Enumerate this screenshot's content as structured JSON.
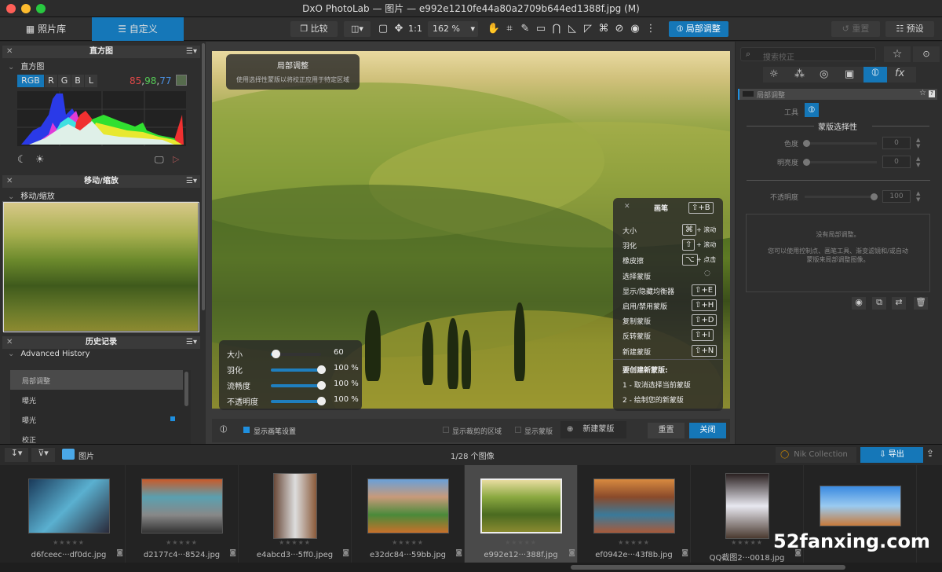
{
  "window": {
    "title": "DxO PhotoLab — 图片 — e992e1210fe44a80a2709b644ed1388f.jpg (M)"
  },
  "toolbar": {
    "tab_library": "照片库",
    "tab_customize": "自定义",
    "compare": "比较",
    "one_to_one": "1:1",
    "zoom": "162 %",
    "local_adjust": "局部调整",
    "reset": "重置",
    "presets": "预设",
    "accent": "#1577b8"
  },
  "left": {
    "histogram": {
      "panel_title": "直方图",
      "section": "直方图",
      "channels": [
        "RGB",
        "R",
        "G",
        "B",
        "L"
      ],
      "active_channel": "RGB",
      "r": "85",
      "g": "98",
      "b": "77",
      "sep": ","
    },
    "move_zoom": {
      "panel_title": "移动/缩放",
      "section": "移动/缩放"
    },
    "history": {
      "panel_title": "历史记录",
      "section": "Advanced History",
      "items": [
        "局部调整",
        "曝光",
        "曝光",
        "校正"
      ]
    }
  },
  "canvas": {
    "tooltip": {
      "title": "局部调整",
      "text": "使用选择性蒙版以将校正应用于特定区域"
    },
    "brush": {
      "title": "画笔",
      "title_key": "⇧+B",
      "rows": [
        {
          "label": "大小",
          "key": "⌘",
          "action": "+ 滚动"
        },
        {
          "label": "羽化",
          "key": "⇧",
          "action": "+ 滚动"
        },
        {
          "label": "橡皮擦",
          "key": "⌥",
          "action": "+ 点击"
        },
        {
          "label": "选择蒙版",
          "key": "",
          "action": ""
        },
        {
          "label": "显示/隐藏均衡器",
          "key": "⇧+E",
          "action": ""
        },
        {
          "label": "启用/禁用蒙版",
          "key": "⇧+H",
          "action": ""
        },
        {
          "label": "复制蒙版",
          "key": "⇧+D",
          "action": ""
        },
        {
          "label": "反转蒙版",
          "key": "⇧+I",
          "action": ""
        },
        {
          "label": "新建蒙版",
          "key": "⇧+N",
          "action": ""
        }
      ],
      "howto_title": "要创建新蒙版:",
      "step1": "1 - 取消选择当前蒙版",
      "step2": "2 - 绘制您的新蒙版"
    },
    "sliders": [
      {
        "label": "大小",
        "value": "60",
        "level": 0.1
      },
      {
        "label": "羽化",
        "value": "100 %",
        "level": 1
      },
      {
        "label": "流畅度",
        "value": "100 %",
        "level": 1
      },
      {
        "label": "不透明度",
        "value": "100 %",
        "level": 1
      }
    ],
    "bottom": {
      "show_brush_settings": "显示画笔设置",
      "show_crop": "显示裁剪的区域",
      "show_mask": "显示蒙版",
      "new_mask": "新建蒙版",
      "reset": "重置",
      "close": "关闭"
    }
  },
  "right": {
    "search_placeholder": "搜索校正",
    "panel_title": "局部调整",
    "tool_label": "工具",
    "mask_selectivity": "蒙版选择性",
    "chroma": "色度",
    "chroma_value": "0",
    "luma": "明亮度",
    "luma_value": "0",
    "opacity": "不透明度",
    "opacity_value": "100",
    "empty_title": "没有局部调整。",
    "empty_text": "您可以使用控制点、画笔工具、渐变滤镜和/或自动蒙版来局部调整图像。"
  },
  "filmstrip": {
    "folder": "图片",
    "count": "1/28 个图像",
    "nik": "Nik Collection",
    "export": "导出",
    "stars": "★★★★★",
    "items": [
      {
        "name": "d6fceec···df0dc.jpg"
      },
      {
        "name": "d2177c4···8524.jpg"
      },
      {
        "name": "e4abcd3···5ff0.jpeg"
      },
      {
        "name": "e32dc84···59bb.jpg"
      },
      {
        "name": "e992e12···388f.jpg",
        "selected": true
      },
      {
        "name": "ef0942e···43f8b.jpg"
      },
      {
        "name": "QQ截图2···0018.jpg"
      },
      {
        "name": ""
      }
    ]
  },
  "watermark": "52fanxing.com"
}
